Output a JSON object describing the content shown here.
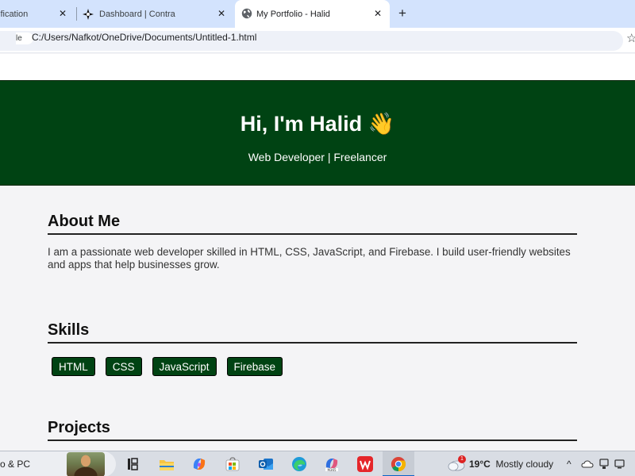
{
  "browser": {
    "tabs": [
      {
        "title": "ification"
      },
      {
        "title": "Dashboard | Contra"
      },
      {
        "title": "My Portfolio - Halid"
      }
    ],
    "address": {
      "site_chip": "le",
      "url": "C:/Users/Nafkot/OneDrive/Documents/Untitled-1.html"
    }
  },
  "page": {
    "hero": {
      "title": "Hi, I'm Halid 👋",
      "subtitle": "Web Developer | Freelancer"
    },
    "about": {
      "heading": "About Me",
      "text": "I am a passionate web developer skilled in HTML, CSS, JavaScript, and Firebase. I build user-friendly websites and apps that help businesses grow."
    },
    "skills": {
      "heading": "Skills",
      "items": [
        "HTML",
        "CSS",
        "JavaScript",
        "Firebase"
      ]
    },
    "projects": {
      "heading": "Projects"
    }
  },
  "taskbar": {
    "search_text": "o & PC",
    "weather": {
      "badge": "1",
      "temp": "19°C",
      "condition": "Mostly cloudy"
    },
    "icons": [
      "task-view-icon",
      "file-explorer-icon",
      "copilot-icon",
      "microsoft-store-icon",
      "outlook-icon",
      "edge-icon",
      "m365-copilot-icon",
      "wps-office-icon",
      "chrome-icon"
    ]
  },
  "colors": {
    "accent_green": "#004313",
    "tab_strip": "#d3e3fd",
    "page_bg": "#f4f4f6"
  }
}
